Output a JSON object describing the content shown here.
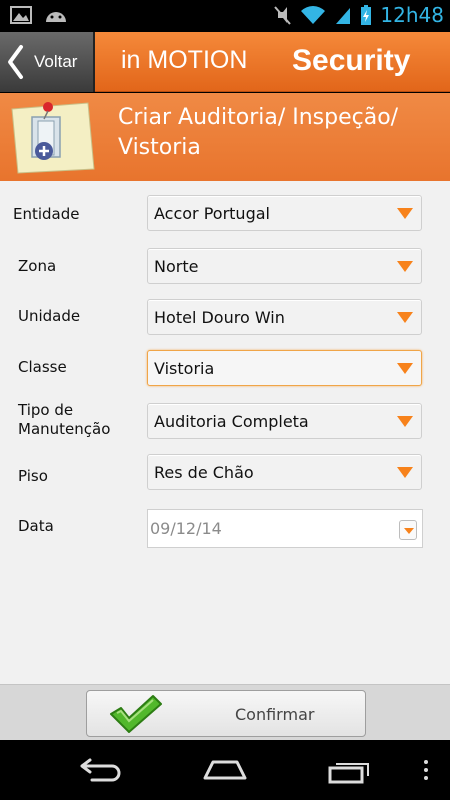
{
  "status_bar": {
    "time": "12h48",
    "icons": [
      "image-icon",
      "android-icon",
      "mute-icon",
      "wifi-icon",
      "signal-icon",
      "battery-charging-icon"
    ]
  },
  "header": {
    "back_label": "Voltar",
    "app_name": "in MOTION",
    "section": "Security"
  },
  "banner": {
    "title": "Criar Auditoria/ Inspeção/ Vistoria",
    "icon": "pinned-note-add-icon"
  },
  "form": {
    "fields": [
      {
        "label": "Entidade",
        "value": "Accor Portugal"
      },
      {
        "label": "Zona",
        "value": "Norte"
      },
      {
        "label": "Unidade",
        "value": "Hotel Douro Win"
      },
      {
        "label": "Classe",
        "value": "Vistoria"
      },
      {
        "label": "Tipo de Manutenção",
        "value": "Auditoria Completa"
      },
      {
        "label": "Piso",
        "value": "Res de Chão"
      }
    ],
    "date": {
      "label": "Data",
      "value": "09/12/14"
    }
  },
  "footer": {
    "confirm_label": "Confirmar"
  },
  "colors": {
    "accent": "#f7821b",
    "header_orange": "#e8742d",
    "status_blue": "#33b5e5"
  }
}
